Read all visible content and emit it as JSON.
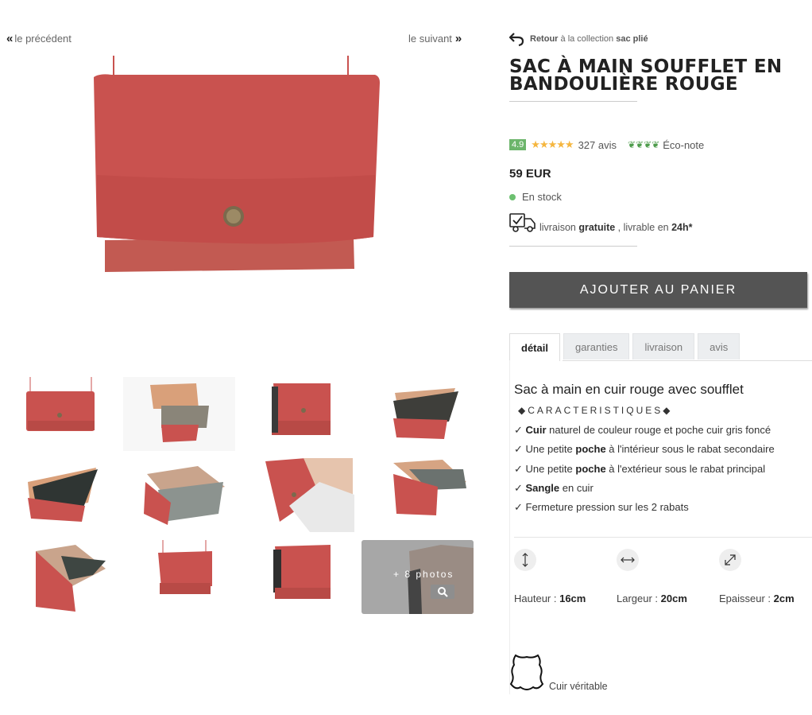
{
  "nav": {
    "prev_label": "le précédent",
    "next_label": "le suivant"
  },
  "back": {
    "retour": "Retour",
    "middle": "à la collection",
    "collection": "sac plié"
  },
  "product": {
    "title": "SAC À MAIN SOUFFLET EN BANDOULIÈRE ROUGE",
    "rating": "4.9",
    "reviews": "327 avis",
    "eco_label": "Éco-note",
    "price": "59 EUR",
    "stock": "En stock",
    "delivery": {
      "text1": "livraison",
      "bold1": "gratuite",
      "text2": ", livrable en",
      "bold2": "24h*"
    },
    "add_to_cart": "AJOUTER AU PANIER"
  },
  "gallery": {
    "more_photos": "+ 8 photos"
  },
  "tabs": [
    "détail",
    "garanties",
    "livraison",
    "avis"
  ],
  "details": {
    "heading": "Sac à main en cuir rouge avec soufflet",
    "caract": "◆CARACTERISTIQUES◆",
    "features": [
      {
        "bold": "Cuir",
        "rest": " naturel de couleur rouge et poche cuir gris foncé",
        "pre": ""
      },
      {
        "pre": "Une petite ",
        "bold": "poche",
        "rest": " à l'intérieur sous le rabat secondaire"
      },
      {
        "pre": "Une petite ",
        "bold": "poche",
        "rest": " à l'extérieur sous le rabat principal"
      },
      {
        "pre": "",
        "bold": "Sangle",
        "rest": " en cuir"
      },
      {
        "pre": "Fermeture pression sur les 2 rabats",
        "bold": "",
        "rest": ""
      }
    ],
    "dimensions": [
      {
        "label": "Hauteur : ",
        "value": "16cm"
      },
      {
        "label": "Largeur : ",
        "value": "20cm"
      },
      {
        "label": "Epaisseur : ",
        "value": "2cm"
      }
    ],
    "leather_label": "Cuir véritable"
  },
  "colors": {
    "leather_red": "#c9524f",
    "button_bg": "#545454",
    "rating_green": "#6cb56b",
    "star_gold": "#f5b63f"
  }
}
